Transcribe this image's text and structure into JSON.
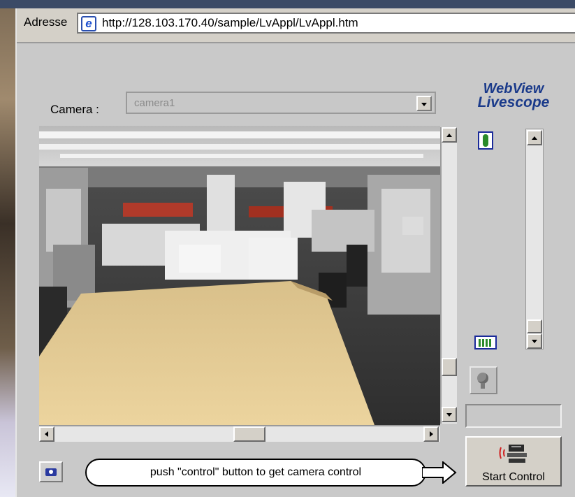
{
  "address_bar": {
    "label": "Adresse",
    "url": "http://128.103.170.40/sample/LvAppl/LvAppl.htm"
  },
  "logo": {
    "line1": "WebView",
    "line2": "Livescope"
  },
  "camera": {
    "label": "Camera :",
    "selected": "camera1"
  },
  "hint": {
    "text": "push \"control\" button to get camera control"
  },
  "start_control": {
    "label": "Start Control"
  },
  "icons": {
    "browser": "ie-page-icon",
    "zoom_in": "zoom-tele-icon",
    "zoom_out": "zoom-wide-icon",
    "focus": "focus-icon",
    "snapshot": "camera-snapshot-icon",
    "control": "camera-control-icon"
  },
  "colors": {
    "logo": "#1a3a8a",
    "window_bg": "#c9c9c9",
    "zoom_icon_green": "#2a8a2a"
  }
}
